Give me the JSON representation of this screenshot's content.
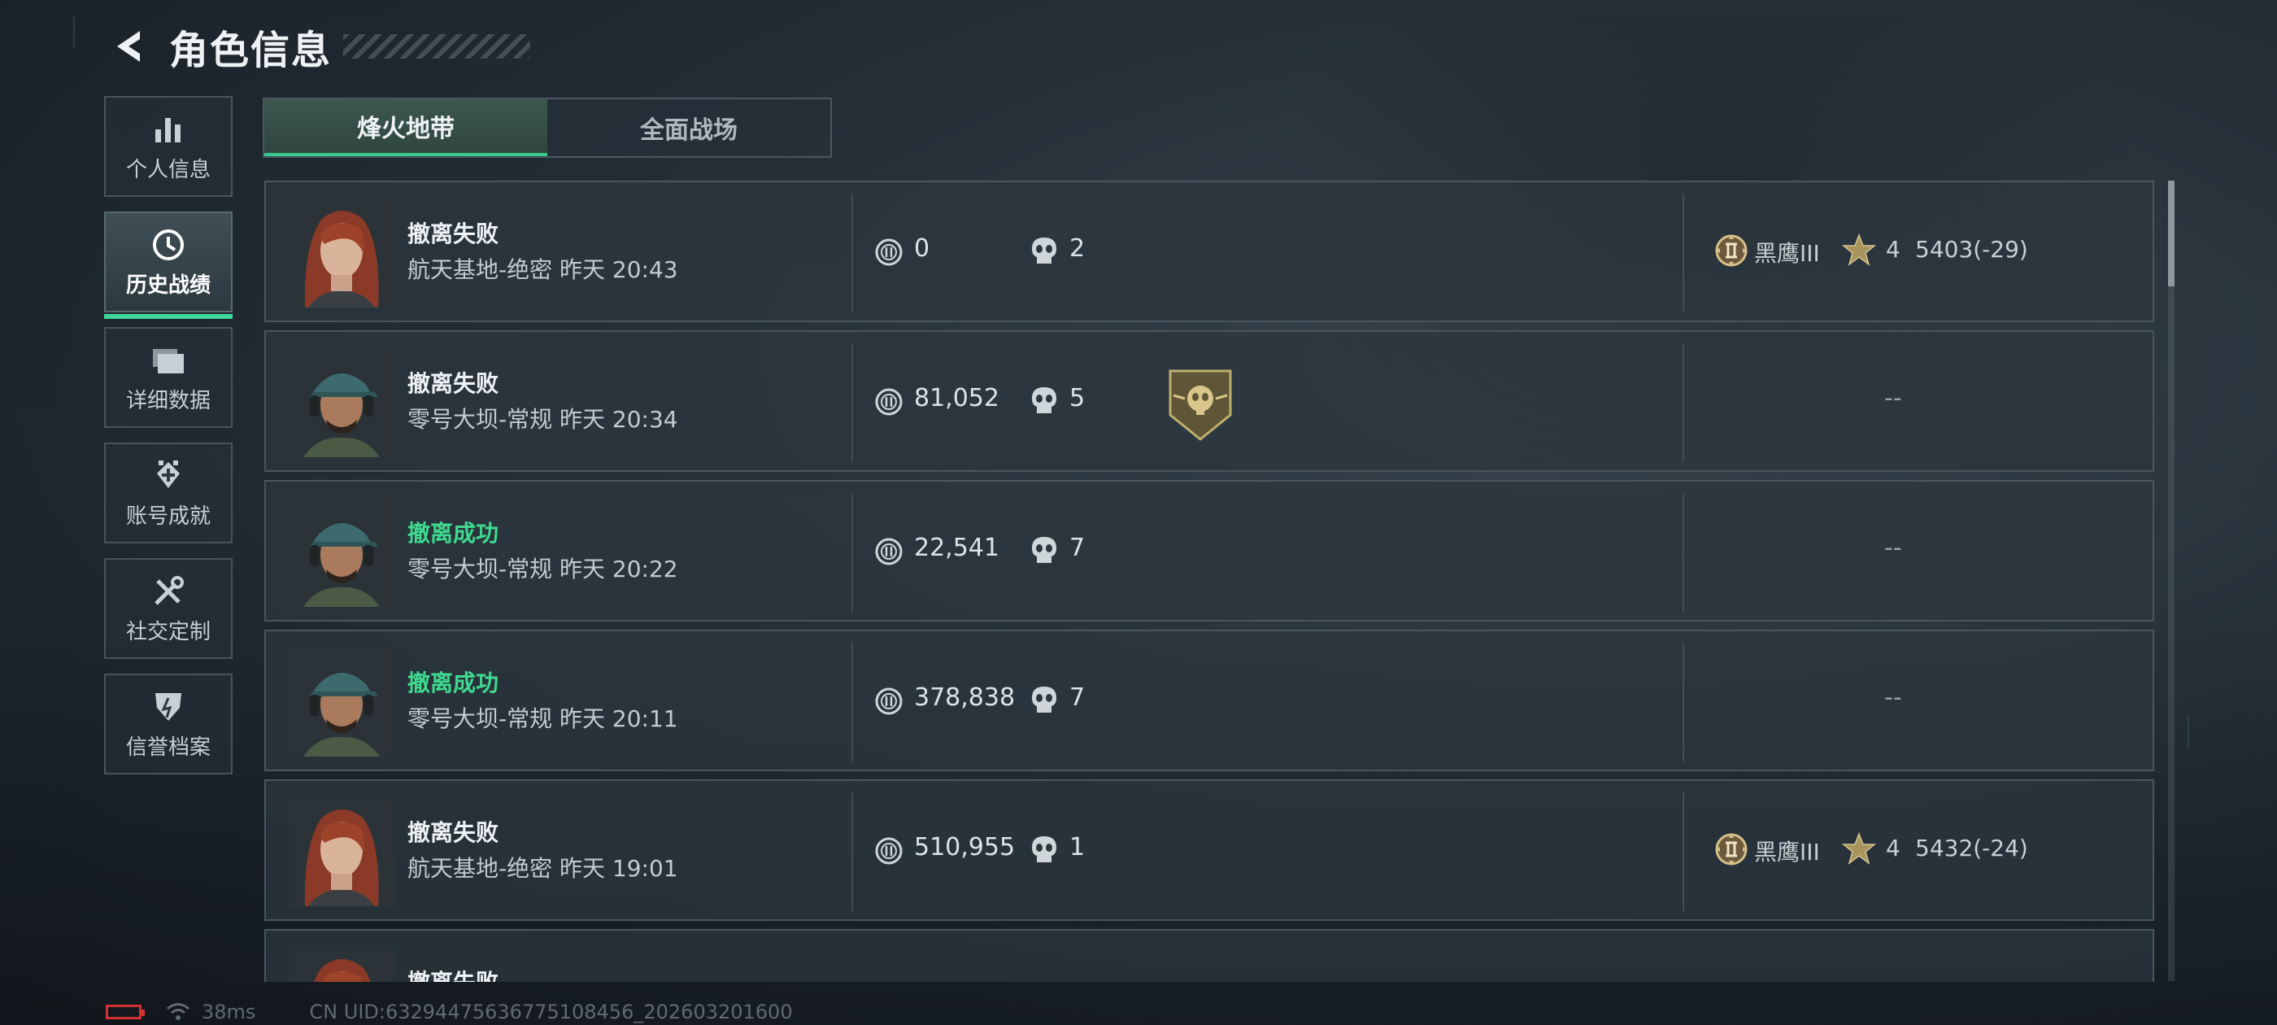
{
  "header": {
    "title": "角色信息"
  },
  "nav": [
    {
      "label": "个人信息",
      "icon": "bar-chart-icon"
    },
    {
      "label": "历史战绩",
      "icon": "history-clock-icon"
    },
    {
      "label": "详细数据",
      "icon": "folder-stack-icon"
    },
    {
      "label": "账号成就",
      "icon": "achievement-icon"
    },
    {
      "label": "社交定制",
      "icon": "tools-icon"
    },
    {
      "label": "信誉档案",
      "icon": "reputation-icon"
    }
  ],
  "tabs": [
    "烽火地带",
    "全面战场"
  ],
  "records": [
    {
      "status": "撤离失败",
      "success": false,
      "map": "航天基地-绝密",
      "time": "昨天 20:43",
      "value": "0",
      "kills": "2",
      "rank": "黑鹰III",
      "stars": "4",
      "score": "5403(-29)",
      "avatar": "female-red-hair"
    },
    {
      "status": "撤离失败",
      "success": false,
      "map": "零号大坝-常规",
      "time": "昨天 20:34",
      "value": "81,052",
      "kills": "5",
      "badge": "skull-shield-badge-icon",
      "dash": "--",
      "avatar": "male-cap-headset"
    },
    {
      "status": "撤离成功",
      "success": true,
      "map": "零号大坝-常规",
      "time": "昨天 20:22",
      "value": "22,541",
      "kills": "7",
      "dash": "--",
      "avatar": "male-cap-headset"
    },
    {
      "status": "撤离成功",
      "success": true,
      "map": "零号大坝-常规",
      "time": "昨天 20:11",
      "value": "378,838",
      "kills": "7",
      "dash": "--",
      "avatar": "male-cap-headset"
    },
    {
      "status": "撤离失败",
      "success": false,
      "map": "航天基地-绝密",
      "time": "昨天 19:01",
      "value": "510,955",
      "kills": "1",
      "rank": "黑鹰III",
      "stars": "4",
      "score": "5432(-24)",
      "avatar": "female-red-hair"
    },
    {
      "status": "撤离失败",
      "success": false,
      "avatar": "female-red-hair"
    }
  ],
  "footer": {
    "ping": "38ms",
    "uid": "CN UID:632944756367751084​56_202603201600"
  },
  "colors": {
    "accent": "#40d79a",
    "success": "#3fd98f",
    "battery": "#d23232"
  }
}
